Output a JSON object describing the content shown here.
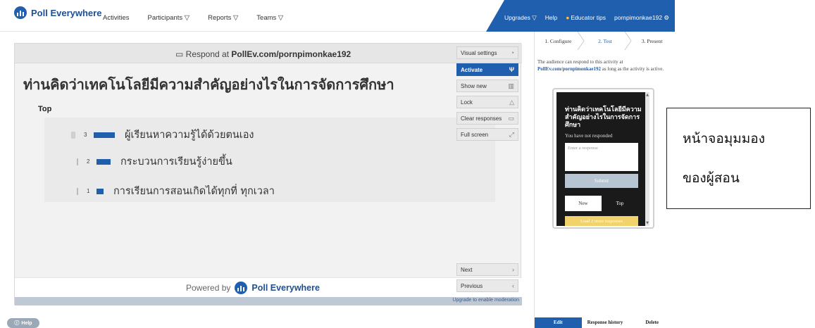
{
  "app": {
    "name": "Poll Everywhere",
    "nav": [
      "Activities",
      "Participants ▽",
      "Reports ▽",
      "Teams ▽"
    ],
    "upgrades": "Upgrades ▽",
    "help": "Help",
    "educator_tips": "Educator tips",
    "user": "pornpimonkae192 ⚙"
  },
  "stage": {
    "respond_prefix": "Respond at ",
    "respond_url": "PollEv.com/pornpimonkae192",
    "question": "ท่านคิดว่าเทคโนโลยีมีความสำคัญอย่างไรในการจัดการศึกษา",
    "top_label": "Top",
    "results": [
      {
        "count": 3,
        "text": "ผู้เรียนหาความรู้ได้ด้วยตนเอง"
      },
      {
        "count": 2,
        "text": "กระบวนการเรียนรู้ง่ายขึ้น"
      },
      {
        "count": 1,
        "text": "การเรียนการสอนเกิดได้ทุกที่ ทุกเวลา"
      }
    ],
    "powered_by": "Powered by",
    "powered_brand": "Poll Everywhere",
    "upgrade_note": "Upgrade to enable moderation"
  },
  "controls": {
    "visual_settings": "Visual settings",
    "activate": "Activate",
    "show_new": "Show new",
    "lock": "Lock",
    "clear_responses": "Clear responses",
    "full_screen": "Full screen",
    "next": "Next",
    "previous": "Previous"
  },
  "panel": {
    "steps": [
      "1. Configure",
      "2. Test",
      "3. Present"
    ],
    "info_pre": "The audience can respond to this activity at",
    "info_url": "PollEv.com/pornpimonkae192",
    "info_post": "as long as the activity is active.",
    "phone": {
      "question": "ท่านคิดว่าเทคโนโลยีมีความสำคัญอย่างไรในการจัดการศึกษา",
      "status": "You have not responded",
      "placeholder": "Enter a response",
      "submit": "Submit",
      "tab_new": "New",
      "tab_top": "Top",
      "load_more": "Load 2 more responses"
    },
    "bottom_tabs": [
      "Edit",
      "Response history",
      "Delete"
    ]
  },
  "annotation": {
    "line1": "หน้าจอมุมมอง",
    "line2": "ของผู้สอน"
  },
  "help_button": "Help"
}
